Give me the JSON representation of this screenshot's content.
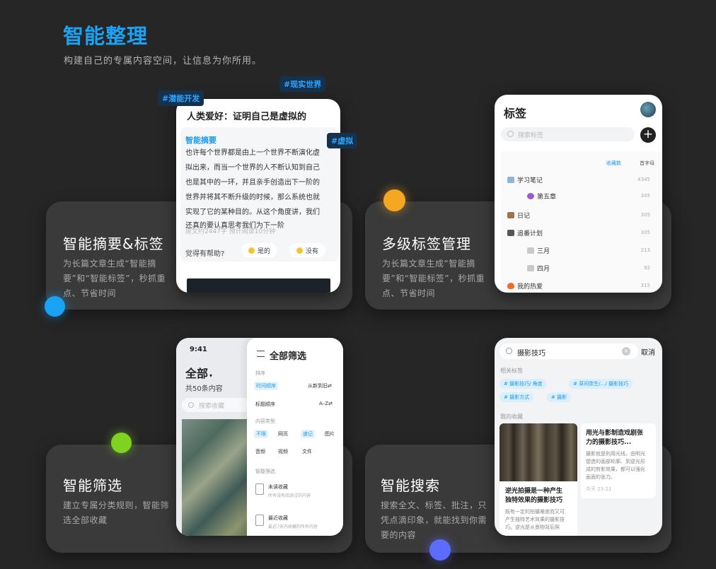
{
  "header": {
    "title": "智能整理",
    "subtitle": "构建自己的专属内容空间，让信息为你所用。"
  },
  "colors": {
    "accent": "#1aa3f5",
    "background": "#262626",
    "card": "#3a3a3a",
    "dot_blue": "#1aa3f5",
    "dot_orange": "#f5a623",
    "dot_green": "#7ed321",
    "dot_purple": "#5b6cff"
  },
  "features": [
    {
      "title": "智能摘要&标签",
      "desc_lines": [
        "为长篇文章生成“智能摘",
        "要”和“智能标签”，秒抓重",
        "点、节省时间"
      ]
    },
    {
      "title": "多级标签管理",
      "desc_lines": [
        "为长篇文章生成“智能摘",
        "要”和“智能标签”，秒抓重",
        "点、节省时间"
      ]
    },
    {
      "title": "智能筛选",
      "desc_lines": [
        "建立专属分类规则，智能筛",
        "选全部收藏"
      ]
    },
    {
      "title": "智能搜索",
      "desc_lines": [
        "搜索全文、标签、批注，只",
        "凭点滴印象，就能找到你需",
        "要的内容"
      ]
    }
  ],
  "floating_tags": [
    "#潜能开发",
    "#现实世界",
    "#虚拟"
  ],
  "summary_phone": {
    "article_title": "人类爱好：证明自己是虚拟的",
    "summary_label": "智能摘要",
    "summary_lines": [
      "也许每个世界都是由上一个世界不断演化虚",
      "拟出来，而当一个世界的人不断认知到自己",
      "也是其中的一环，并且亲手创造出下一阶的",
      "世界并将其不断升级的时候，那么系统也就",
      "实现了它的某种目的。从这个角度讲，我们",
      "还真的要认真思考我们为下一阶"
    ],
    "ghost_text": "原文约2447字 预计阅读10分钟",
    "helpful_question": "觉得有帮助?",
    "yes_label": "是的",
    "no_label": "没有"
  },
  "tags_phone": {
    "heading": "标签",
    "search_placeholder": "搜索标签",
    "add_label": "+",
    "sort_options": [
      "收藏数",
      "首字母"
    ],
    "rows": [
      {
        "label": "学习笔记",
        "count": "4345"
      },
      {
        "label": "第五章",
        "count": "345"
      },
      {
        "label": "日记",
        "count": "305"
      },
      {
        "label": "追番计划",
        "count": "305"
      },
      {
        "label": "三月",
        "count": "213"
      },
      {
        "label": "四月",
        "count": "92"
      },
      {
        "label": "我的热爱",
        "count": "315"
      }
    ]
  },
  "filter_phone": {
    "time": "9:41",
    "all_label": "全部",
    "caret": "▾",
    "count_label": "共50条内容",
    "search_placeholder": "搜索收藏",
    "panel_title": "全部筛选",
    "sort_section": "排序",
    "sort_time": "时间顺序",
    "sort_time_value": "从新到旧⇄",
    "sort_title": "标题顺序",
    "sort_title_value": "A–Z⇄",
    "type_section": "内容类型",
    "types_row1": [
      "不限",
      "网页",
      "速记",
      "图片"
    ],
    "types_row2": [
      "音频",
      "视频",
      "文件"
    ],
    "smart_section": "智能筛选",
    "smart_items": [
      {
        "title": "未读收藏",
        "sub": "所有没有阅读过的内容"
      },
      {
        "title": "最近收藏",
        "sub": "最近7天内收藏的所有内容"
      }
    ]
  },
  "search_phone": {
    "query": "摄影技巧",
    "clear_label": "×",
    "cancel_label": "取消",
    "related_tags_label": "相关标签",
    "tag_chips": [
      "#  摄影技巧/   角度",
      "#  草间弥生/…/  摄影技巧",
      "#  摄影方式",
      "#  摄影"
    ],
    "my_collection_label": "我的收藏",
    "card1_title_lines": [
      "逆光拍摄是一种产生",
      "独特效果的摄影技巧"
    ],
    "card1_body_lines": [
      "既有一定的拍摄难度而又可",
      "产生独特艺术效果的摄影技",
      "巧。逆光是从景物背后照"
    ],
    "card2_title_lines": [
      "用光与影制造戏剧张",
      "力的摄影技巧..."
    ],
    "card2_body_lines": [
      "摄影就是利用光线，由明光",
      "塑造的画部轮廓、到逆光形",
      "成的剪影效果，都可以强化",
      "画面的张力。"
    ],
    "card2_time": "今天 23:21"
  }
}
